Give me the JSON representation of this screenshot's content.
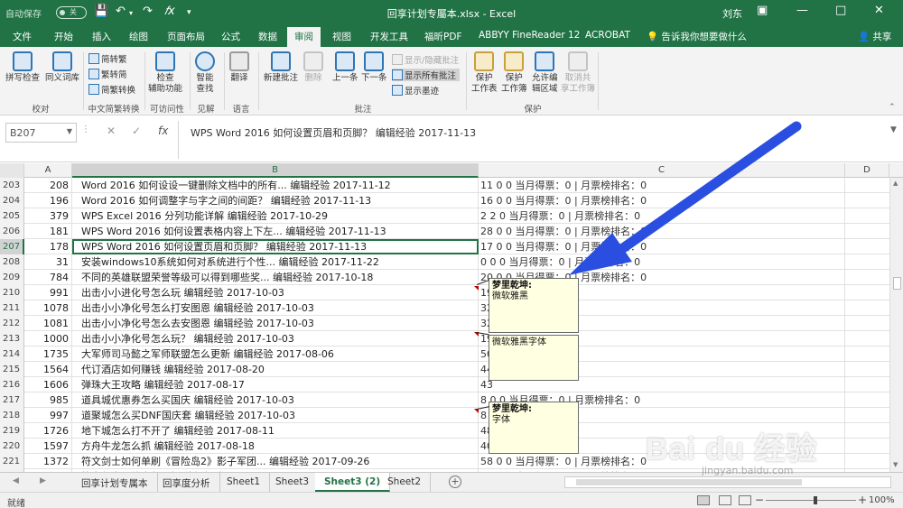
{
  "titlebar": {
    "autosave": "自动保存",
    "autosave_state": "关",
    "title": "回享计划专屬本.xlsx - Excel",
    "user": "刘东",
    "save_icon": "save-icon",
    "undo_icon": "undo-icon",
    "redo_icon": "redo-icon",
    "fx_icon": "fx-icon"
  },
  "tabs": [
    "文件",
    "开始",
    "插入",
    "绘图",
    "页面布局",
    "公式",
    "数据",
    "审阅",
    "视图",
    "开发工具",
    "福昕PDF",
    "ABBYY FineReader 12",
    "ACROBAT",
    "告诉我你想要做什么"
  ],
  "active_tab": "审阅",
  "share_label": "共享",
  "ribbon": {
    "proofing": {
      "spell": "拼写检查",
      "thesaurus": "同义词库",
      "label": "校对"
    },
    "chinese": {
      "to_trad": "简转繁",
      "to_simp": "繁转简",
      "convert": "简繁转换",
      "label": "中文简繁转换"
    },
    "access": {
      "check_line1": "检查",
      "check_line2": "辅助功能",
      "label": "可访问性"
    },
    "insights": {
      "smart_line1": "智能",
      "smart_line2": "查找",
      "label": "见解"
    },
    "language": {
      "translate": "翻译",
      "label": "语言"
    },
    "comments": {
      "new": "新建批注",
      "delete": "删除",
      "prev": "上一条",
      "next": "下一条",
      "show_hide": "显示/隐藏批注",
      "show_all": "显示所有批注",
      "show_ink": "显示墨迹",
      "label": "批注"
    },
    "protect": {
      "protect_sheet_1": "保护",
      "protect_sheet_2": "工作表",
      "protect_book_1": "保护",
      "protect_book_2": "工作簿",
      "allow_edit_1": "允许编",
      "allow_edit_2": "辑区域",
      "unshare_1": "取消共",
      "unshare_2": "享工作簿",
      "label": "保护"
    }
  },
  "formula_bar": {
    "name_box": "B207",
    "formula": "WPS Word 2016 如何设置页眉和页脚？ 编辑经验 2017-11-13"
  },
  "columns": {
    "a": "A",
    "b": "B",
    "c": "C",
    "d": "D"
  },
  "rows": [
    {
      "n": "203",
      "a": "208",
      "b": "Word 2016 如何设设一键删除文档中的所有... 编辑经验 2017-11-12",
      "c": "11 0 0 当月得票：0 | 月票榜排名：0"
    },
    {
      "n": "204",
      "a": "196",
      "b": "Word 2016 如何调整字与字之间的间距？ 编辑经验 2017-11-13",
      "c": "16 0 0 当月得票：0 | 月票榜排名：0"
    },
    {
      "n": "205",
      "a": "379",
      "b": "WPS Excel 2016 分列功能详解 编辑经验 2017-10-29",
      "c": "2 2 0 当月得票：0 | 月票榜排名：0"
    },
    {
      "n": "206",
      "a": "181",
      "b": "WPS Word 2016 如何设置表格内容上下左... 编辑经验 2017-11-13",
      "c": "28 0 0 当月得票：0 | 月票榜排名：0"
    },
    {
      "n": "207",
      "a": "178",
      "b": "WPS Word 2016 如何设置页眉和页脚？ 编辑经验 2017-11-13",
      "c": "17 0 0 当月得票：0 | 月票榜排名：0"
    },
    {
      "n": "208",
      "a": "31",
      "b": "安装windows10系统如何对系统进行个性... 编辑经验 2017-11-22",
      "c": "0 0 0 当月得票：0 | 月票榜排名：0"
    },
    {
      "n": "209",
      "a": "784",
      "b": "不同的英雄联盟荣誉等级可以得到哪些奖... 编辑经验 2017-10-18",
      "c": "20 0 0 当月得票：0 | 月票榜排名：0"
    },
    {
      "n": "210",
      "a": "991",
      "b": "出击小小进化号怎么玩 编辑经验 2017-10-03",
      "c": "19"
    },
    {
      "n": "211",
      "a": "1078",
      "b": "出击小小净化号怎么打安图恩 编辑经验 2017-10-03",
      "c": "32"
    },
    {
      "n": "212",
      "a": "1081",
      "b": "出击小小净化号怎么去安图恩 编辑经验 2017-10-03",
      "c": "32"
    },
    {
      "n": "213",
      "a": "1000",
      "b": "出击小小净化号怎么玩？ 编辑经验 2017-10-03",
      "c": "19"
    },
    {
      "n": "214",
      "a": "1735",
      "b": "大军师司马懿之军师联盟怎么更新 编辑经验 2017-08-06",
      "c": "50"
    },
    {
      "n": "215",
      "a": "1564",
      "b": "代订酒店如何赚钱 编辑经验 2017-08-20",
      "c": "44"
    },
    {
      "n": "216",
      "a": "1606",
      "b": "弹珠大王攻略 编辑经验 2017-08-17",
      "c": "43"
    },
    {
      "n": "217",
      "a": "985",
      "b": "道具城优惠券怎么买国庆 编辑经验 2017-10-03",
      "c": "8 0 0 当月得票：0 | 月票榜排名：0"
    },
    {
      "n": "218",
      "a": "997",
      "b": "道聚城怎么买DNF国庆套 编辑经验 2017-10-03",
      "c": "8"
    },
    {
      "n": "219",
      "a": "1726",
      "b": "地下城怎么打不开了 编辑经验 2017-08-11",
      "c": "48"
    },
    {
      "n": "220",
      "a": "1597",
      "b": "方舟牛龙怎么抓 编辑经验 2017-08-18",
      "c": "40"
    },
    {
      "n": "221",
      "a": "1372",
      "b": "符文剑士如何单刷《冒险岛2》影子军团... 编辑经验 2017-09-26",
      "c": "58 0 0 当月得票：0 | 月票榜排名：0"
    },
    {
      "n": "222",
      "a": "1054",
      "b": "符文剑士最终大怎么打 编辑经验 2017-09-29",
      "c": "70 0 0 当月得票：0 | 月票榜排名：0"
    }
  ],
  "comments": [
    {
      "author": "梦里乾坤:",
      "text": "微软雅黑"
    },
    {
      "author": "",
      "text": "微软雅黑字体"
    },
    {
      "author": "梦里乾坤:",
      "text": "字体"
    }
  ],
  "sheets": [
    "回享计划专属本",
    "回享度分析",
    "Sheet1",
    "Sheet3",
    "Sheet3 (2)",
    "Sheet2"
  ],
  "active_sheet": "Sheet3 (2)",
  "status": {
    "ready": "就绪",
    "zoom": "100%"
  },
  "watermark": {
    "logo": "Bai du 经验",
    "url": "jingyan.baidu.com"
  },
  "colors": {
    "excel_green": "#217346",
    "arrow_blue": "#2a4fe0",
    "comment_bg": "#ffffe1"
  }
}
